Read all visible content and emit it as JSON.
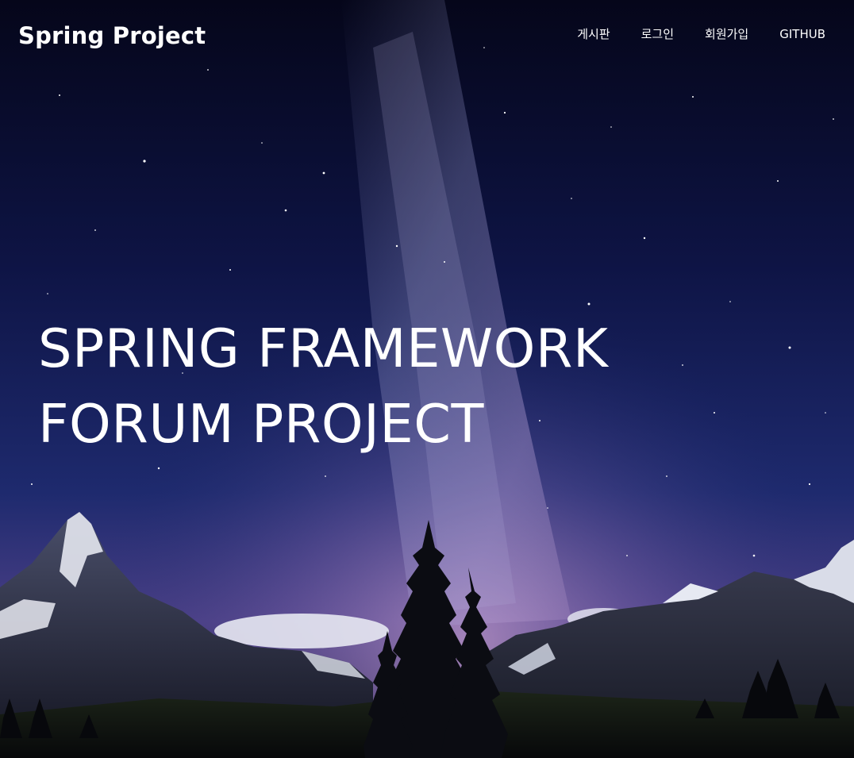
{
  "navbar": {
    "brand": "Spring Project",
    "menu": [
      {
        "label": "게시판"
      },
      {
        "label": "로그인"
      },
      {
        "label": "회원가입"
      },
      {
        "label": "GITHUB"
      }
    ]
  },
  "hero": {
    "title_line1": "SPRING FRAMEWORK",
    "title_line2": "FORUM PROJECT",
    "background": "night-sky-milky-way-mountains-image"
  },
  "colors": {
    "sky_top": "#070821",
    "sky_mid": "#1a2566",
    "milky_way": "#8a7fb8",
    "horizon_glow": "#b68fc7",
    "mountain": "#1d2030",
    "snow": "#e9ecf4",
    "text": "#ffffff"
  }
}
